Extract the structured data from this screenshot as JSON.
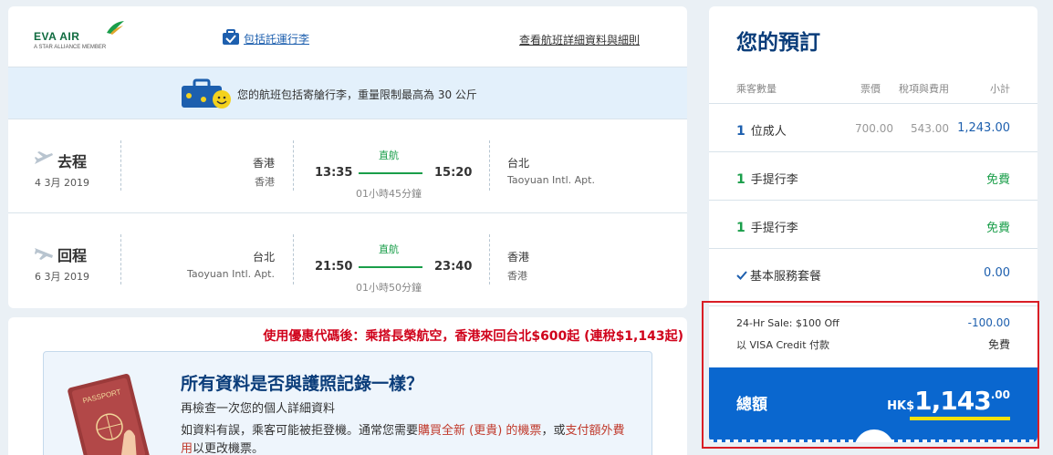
{
  "header": {
    "logo_text": "EVA AIR",
    "logo_sub": "A STAR ALLIANCE MEMBER",
    "baggage_link": "包括託運行李",
    "details_link": "查看航班詳細資料與細則"
  },
  "banner": {
    "text": "您的航班包括寄艙行李，重量限制最高為 30 公斤"
  },
  "legs": [
    {
      "direction": "去程",
      "date": "4 3月 2019",
      "from_city": "香港",
      "from_airport": "香港",
      "depart": "13:35",
      "type": "直航",
      "duration": "01小時45分鐘",
      "arrive": "15:20",
      "to_city": "台北",
      "to_airport": "Taoyuan Intl. Apt."
    },
    {
      "direction": "回程",
      "date": "6 3月 2019",
      "from_city": "台北",
      "from_airport": "Taoyuan Intl. Apt.",
      "depart": "21:50",
      "type": "直航",
      "duration": "01小時50分鐘",
      "arrive": "23:40",
      "to_city": "香港",
      "to_airport": "香港"
    }
  ],
  "promo": {
    "text": "使用優惠代碼後：乘搭長榮航空，香港來回台北$600起 (連稅$1,143起)"
  },
  "passport_notice": {
    "title": "所有資料是否與護照記錄一樣？",
    "subtitle": "再檢查一次您的個人詳細資料",
    "body_1": "如資料有誤，乘客可能被拒登機。通常您需要",
    "body_red_1": "購買全新 (更貴) 的機票",
    "body_2": "，或",
    "body_red_2": "支付額外費用",
    "body_3": "以更改機票。"
  },
  "booking": {
    "title": "您的預訂",
    "headers": {
      "passengers": "乘客數量",
      "fare": "票價",
      "taxes": "稅項與費用",
      "subtotal": "小計"
    },
    "adult": {
      "count": "1",
      "label": "位成人",
      "fare": "700.00",
      "taxes": "543.00",
      "subtotal": "1,243.00"
    },
    "bag1": {
      "count": "1",
      "label": "手提行李",
      "value": "免費"
    },
    "bag2": {
      "count": "1",
      "label": "手提行李",
      "value": "免費"
    },
    "service": {
      "label": "基本服務套餐",
      "value": "0.00"
    },
    "discount": {
      "label": "24-Hr Sale: $100 Off",
      "value": "-100.00"
    },
    "payment": {
      "label": "以 VISA Credit 付款",
      "value": "免費"
    },
    "total": {
      "label": "總額",
      "currency": "HK$",
      "amount": "1,143",
      "decimals": ".00"
    }
  },
  "colors": {
    "accent_blue": "#0a67cf",
    "title_navy": "#0b3d7a",
    "green": "#1a9e4a",
    "promo_red": "#d0021b",
    "highlight_frame": "#d91e26"
  }
}
